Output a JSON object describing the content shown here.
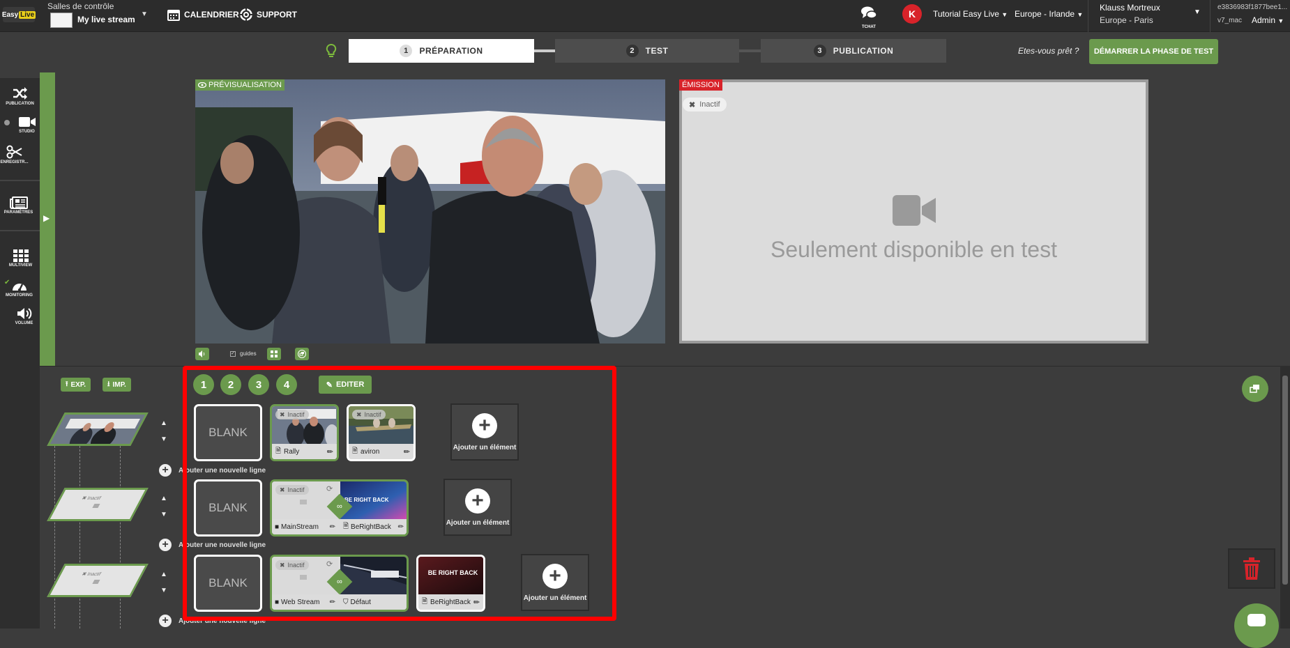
{
  "topbar": {
    "logo_easy": "Easy",
    "logo_live": "Live",
    "room_label": "Salles de contrôle",
    "room_name": "My live stream",
    "calendar": "CALENDRIER",
    "support": "SUPPORT",
    "tchat": "TCHAT",
    "avatar_initial": "K",
    "tutorial": "Tutorial Easy Live",
    "region": "Europe - Irlande",
    "user_name": "Klauss Mortreux",
    "user_tz": "Europe - Paris",
    "session_id": "e3836983f1877bee1...",
    "version": "v7_mac",
    "role": "Admin"
  },
  "phases": {
    "step1_num": "1",
    "step1": "PRÉPARATION",
    "step2_num": "2",
    "step2": "TEST",
    "step3_num": "3",
    "step3": "PUBLICATION",
    "ready": "Etes-vous prêt ?",
    "start_button": "DÉMARRER LA PHASE DE TEST"
  },
  "sidebar": {
    "publication": "PUBLICATION",
    "studio": "STUDIO",
    "enregistrement": "ENREGISTR...",
    "parametres": "PARAMÈTRES",
    "multiview": "MULTIVIEW",
    "monitoring": "MONITORING",
    "volume": "VOLUME"
  },
  "preview": {
    "label": "PRÉVISUALISATION",
    "guides": "guides"
  },
  "emission": {
    "label": "ÉMISSION",
    "status": "Inactif",
    "message": "Seulement disponible en test"
  },
  "bottom": {
    "exp": "EXP.",
    "imp": "IMP.",
    "add_line": "Ajouter une nouvelle ligne"
  },
  "scenes": {
    "tabs": [
      "1",
      "2",
      "3",
      "4"
    ],
    "edit": "EDITER",
    "blank": "BLANK",
    "add_element": "Ajouter un élément",
    "inactive": "Inactif",
    "row1": {
      "card1": "Rally",
      "card2": "aviron"
    },
    "row2": {
      "left": "MainStream",
      "right": "BeRightBack",
      "overlay_text": "BE RIGHT BACK"
    },
    "row3": {
      "left": "Web Stream",
      "right": "Défaut",
      "card": "BeRightBack",
      "card_title": "BE RIGHT BACK"
    }
  },
  "colors": {
    "accent": "#6b9a4d",
    "alert": "#d8232a",
    "bg": "#3c3c3c",
    "bar": "#2c2c2c"
  }
}
